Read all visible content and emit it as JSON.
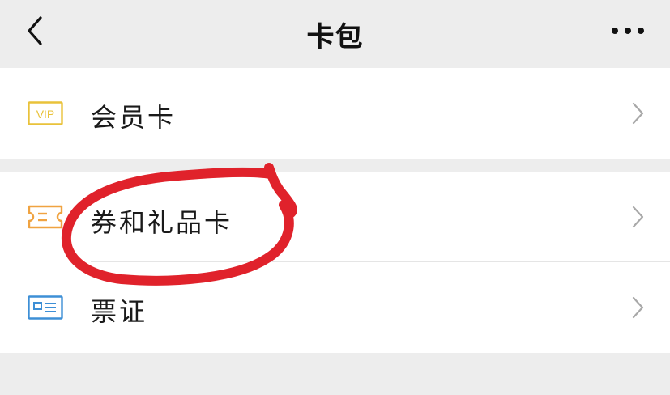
{
  "header": {
    "title": "卡包",
    "back_icon": "chevron-left-icon",
    "more_icon": "more-dots-icon"
  },
  "sections": [
    {
      "items": [
        {
          "label": "会员卡",
          "icon": "vip-card-icon",
          "icon_color": "#e9c23a",
          "icon_text": "VIP"
        }
      ]
    },
    {
      "items": [
        {
          "label": "券和礼品卡",
          "icon": "coupon-icon",
          "icon_color": "#f0a341"
        },
        {
          "label": "票证",
          "icon": "id-card-icon",
          "icon_color": "#3d8fd6"
        }
      ]
    }
  ],
  "colors": {
    "background": "#ededed",
    "row_background": "#ffffff",
    "annotation_red": "#e0222b"
  }
}
